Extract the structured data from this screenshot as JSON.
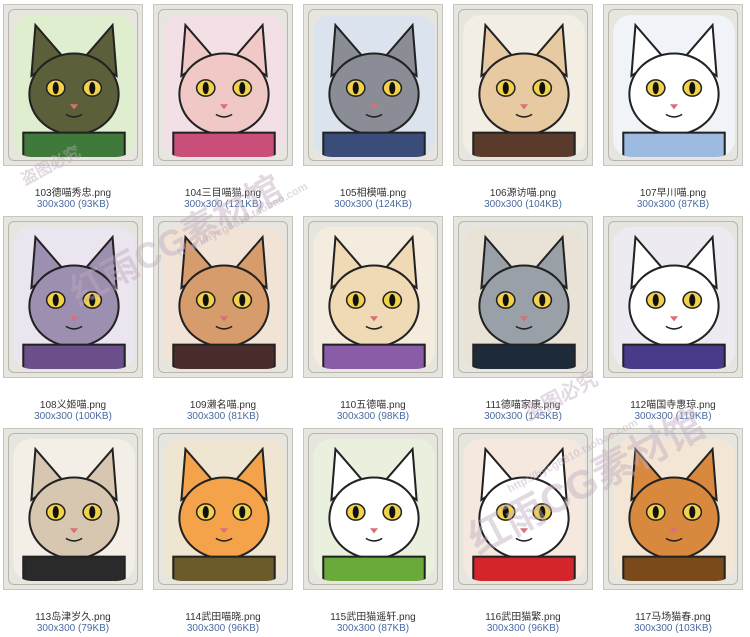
{
  "gallery": {
    "items": [
      {
        "name": "103德喵秀忠.png",
        "size": "300x300 (93KB)",
        "bg": "#dfeecf",
        "fur": "#5b5f3a",
        "accent": "#3f7a3a"
      },
      {
        "name": "104三目喵猫.png",
        "size": "300x300 (121KB)",
        "bg": "#f3dfe6",
        "fur": "#f0c9c6",
        "accent": "#c94f7a"
      },
      {
        "name": "105相模喵.png",
        "size": "300x300 (124KB)",
        "bg": "#dbe3ef",
        "fur": "#8a8d95",
        "accent": "#3a4d7a"
      },
      {
        "name": "106源访喵.png",
        "size": "300x300 (104KB)",
        "bg": "#f2eee4",
        "fur": "#e7c9a2",
        "accent": "#5a3a2a"
      },
      {
        "name": "107早川喵.png",
        "size": "300x300 (87KB)",
        "bg": "#f0f4f8",
        "fur": "#ffffff",
        "accent": "#9dbbe0"
      },
      {
        "name": "108义姬喵.png",
        "size": "300x300 (100KB)",
        "bg": "#ebe5ef",
        "fur": "#9d8fb0",
        "accent": "#6b4f8a"
      },
      {
        "name": "109濑名喵.png",
        "size": "300x300 (81KB)",
        "bg": "#f1e4d6",
        "fur": "#d69c6b",
        "accent": "#4a2c2c"
      },
      {
        "name": "110五德喵.png",
        "size": "300x300 (98KB)",
        "bg": "#f4ecde",
        "fur": "#f0d9b5",
        "accent": "#8a5ca8"
      },
      {
        "name": "111德喵家康.png",
        "size": "300x300 (145KB)",
        "bg": "#e8e3d6",
        "fur": "#9aa0a8",
        "accent": "#1c2a3a"
      },
      {
        "name": "112喵国寺惠琼.png",
        "size": "300x300 (119KB)",
        "bg": "#eeeaf2",
        "fur": "#ffffff",
        "accent": "#4a3a8a"
      },
      {
        "name": "113岛津岁久.png",
        "size": "300x300 (79KB)",
        "bg": "#f3eee6",
        "fur": "#d8c7b0",
        "accent": "#2a2a2a"
      },
      {
        "name": "114武田喵晓.png",
        "size": "300x300 (96KB)",
        "bg": "#efe6d2",
        "fur": "#f4a34a",
        "accent": "#6b5a2a"
      },
      {
        "name": "115武田猫遥轩.png",
        "size": "300x300 (87KB)",
        "bg": "#eaf0de",
        "fur": "#ffffff",
        "accent": "#6aaa3a"
      },
      {
        "name": "116武田猫繁.png",
        "size": "300x300 (96KB)",
        "bg": "#f5e9df",
        "fur": "#ffffff",
        "accent": "#d4262a"
      },
      {
        "name": "117马场猫春.png",
        "size": "300x300 (103KB)",
        "bg": "#f4e6d4",
        "fur": "#d9893e",
        "accent": "#7a4a1a"
      }
    ]
  },
  "watermark": {
    "line1": "盗图必究",
    "line2": "红雨CG素材馆",
    "line3": "http://hycg8810.taobao.com"
  }
}
